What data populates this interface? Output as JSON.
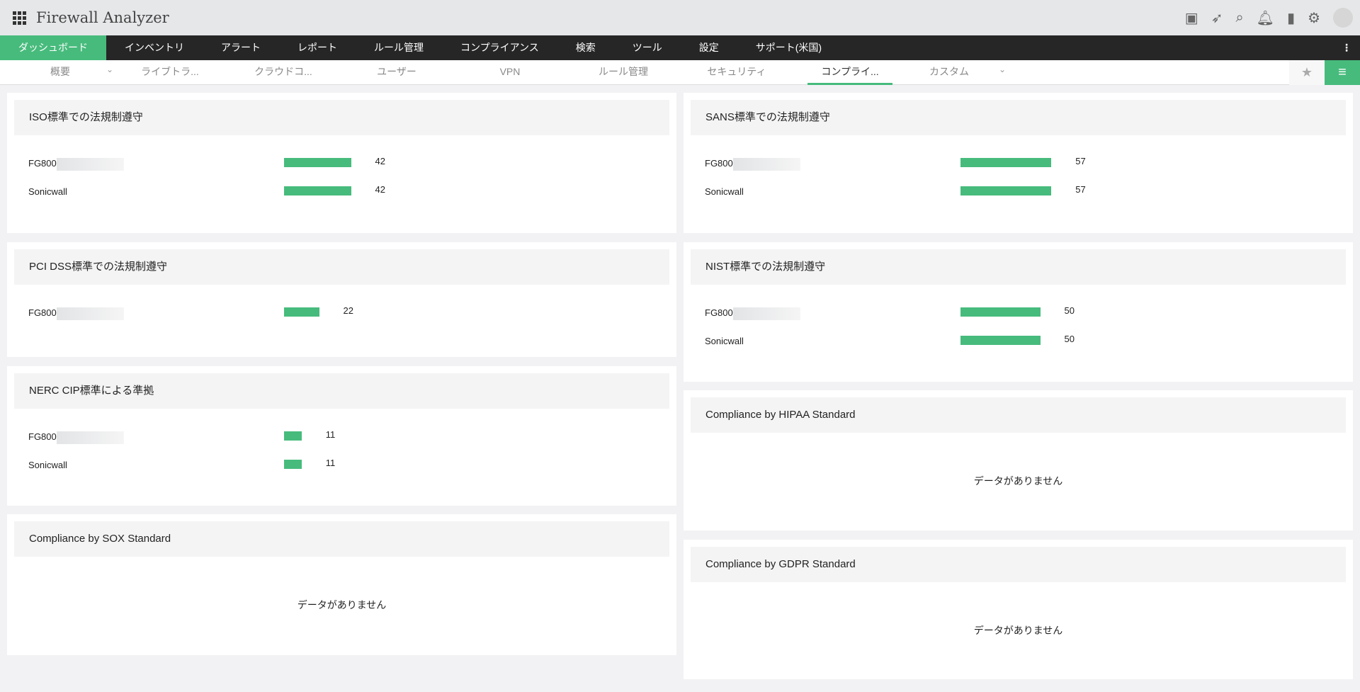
{
  "app": {
    "title": "Firewall Analyzer"
  },
  "nav": [
    "ダッシュボード",
    "インベントリ",
    "アラート",
    "レポート",
    "ルール管理",
    "コンプライアンス",
    "検索",
    "ツール",
    "設定",
    "サポート(米国)"
  ],
  "subnav": [
    "概要",
    "ライブトラ...",
    "クラウドコ...",
    "ユーザー",
    "VPN",
    "ルール管理",
    "セキュリティ",
    "コンプライ...",
    "カスタム"
  ],
  "panels": {
    "iso": {
      "title": "ISO標準での法規制遵守",
      "rows": [
        {
          "device": "FG800",
          "value": 42
        },
        {
          "device": "Sonicwall",
          "value": 42
        }
      ]
    },
    "sans": {
      "title": "SANS標準での法規制遵守",
      "rows": [
        {
          "device": "FG800",
          "value": 57
        },
        {
          "device": "Sonicwall",
          "value": 57
        }
      ]
    },
    "pci": {
      "title": "PCI DSS標準での法規制遵守",
      "rows": [
        {
          "device": "FG800",
          "value": 22
        }
      ]
    },
    "nist": {
      "title": "NIST標準での法規制遵守",
      "rows": [
        {
          "device": "FG800",
          "value": 50
        },
        {
          "device": "Sonicwall",
          "value": 50
        }
      ]
    },
    "nerc": {
      "title": "NERC CIP標準による準拠",
      "rows": [
        {
          "device": "FG800",
          "value": 11
        },
        {
          "device": "Sonicwall",
          "value": 11
        }
      ]
    },
    "hipaa": {
      "title": "Compliance by HIPAA Standard",
      "nodata": "データがありません"
    },
    "sox": {
      "title": "Compliance by SOX Standard",
      "nodata": "データがありません"
    },
    "gdpr": {
      "title": "Compliance by GDPR Standard",
      "nodata": "データがありません"
    }
  },
  "colors": {
    "accent": "#47bb7c",
    "nav_bg": "#262626"
  }
}
